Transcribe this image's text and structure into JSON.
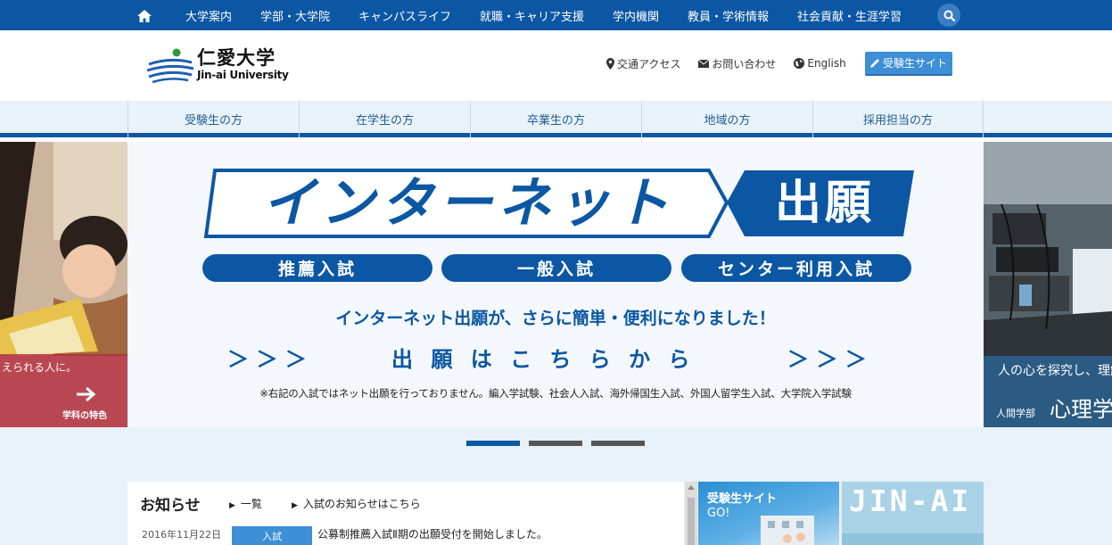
{
  "topnav": {
    "items": [
      "大学案内",
      "学部・大学院",
      "キャンパスライフ",
      "就職・キャリア支援",
      "学内機関",
      "教員・学術情報",
      "社会貢献・生涯学習"
    ]
  },
  "logo": {
    "jp": "仁愛大学",
    "en": "Jin-ai University"
  },
  "header_links": {
    "access": "交通アクセス",
    "contact": "お問い合わせ",
    "english": "English",
    "apply": "受験生サイト"
  },
  "subnav": {
    "tabs": [
      "受験生の方",
      "在学生の方",
      "卒業生の方",
      "地域の方",
      "採用担当の方"
    ]
  },
  "banner": {
    "title_main": "インターネット",
    "title_tag": "出願",
    "pills": [
      "推薦入試",
      "一般入試",
      "センター利用入試"
    ],
    "lead": "インターネット出願が、さらに簡単・便利になりました！",
    "arrows_left": "＞ ＞ ＞",
    "cta": "出 願 は こ ち ら か ら",
    "arrows_right": "＞ ＞ ＞",
    "note": "※右記の入試ではネット出願を行っておりません。編入学試験、社会人入試、海外帰国生入試、外国人留学生入試、大学院入学試験"
  },
  "slide_left": {
    "caption": "えられる人に。",
    "link": "学科の特色"
  },
  "slide_right": {
    "caption": "人の心を探究し、理解",
    "dept": "人間学部",
    "subject": "心理学"
  },
  "news": {
    "title": "お知らせ",
    "link_all": "一覧",
    "link_exam": "入試のお知らせはこちら",
    "items": [
      {
        "date": "2016年11月22日",
        "category": "入試",
        "headline": "公募制推薦入試Ⅱ期の出願受付を開始しました。"
      }
    ]
  },
  "cards": {
    "applicant": {
      "title": "受験生サイト",
      "go": "GO!"
    },
    "spirit": {
      "title": "JIN-AI"
    }
  },
  "colors": {
    "primary": "#0b57a4",
    "accent": "#3d8fd6"
  }
}
